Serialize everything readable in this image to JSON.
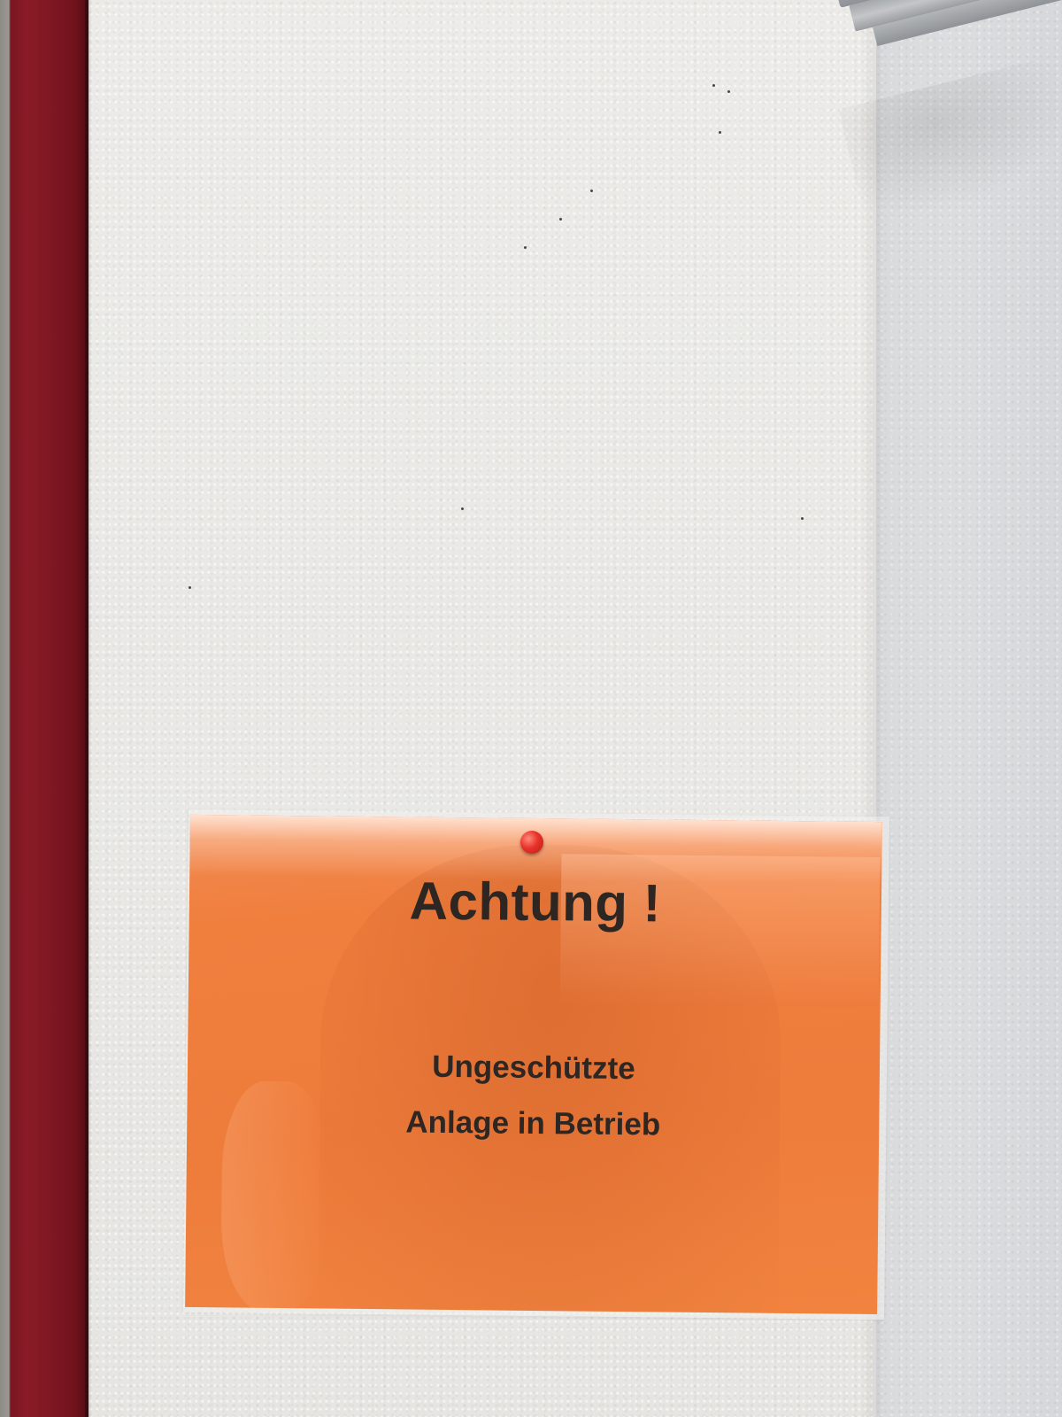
{
  "scene": {
    "description_free": true
  },
  "sign": {
    "title": "Achtung !",
    "line1": "Ungeschützte",
    "line2": "Anlage in Betrieb",
    "colors": {
      "paper": "#f07f3e",
      "text": "#2e2623"
    }
  },
  "frame": {
    "color": "#7e1722"
  },
  "pin": {
    "color": "#e8322a"
  }
}
